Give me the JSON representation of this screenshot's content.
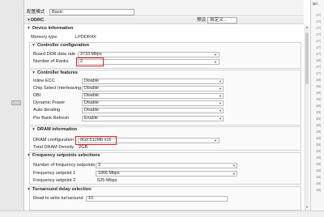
{
  "header": {
    "mode_label": "配置模式",
    "mode_value": "Basic",
    "section_title": "DDRC",
    "preset_label": "预设",
    "preset_value": "自定义..."
  },
  "device_information": {
    "title": "Device Information",
    "memory_type_label": "Memory type",
    "memory_type_value": "LPDDR4X"
  },
  "controller_configuration": {
    "title": "Controller configuration",
    "fields": [
      {
        "label": "Board DDR data rate",
        "value": "3733 Mbps"
      },
      {
        "label": "Number of Ranks",
        "value": "2"
      }
    ]
  },
  "controller_features": {
    "title": "Controller features",
    "fields": [
      {
        "label": "Inline ECC",
        "value": "Disable"
      },
      {
        "label": "Chip Select Interleaving",
        "value": "Disable"
      },
      {
        "label": "DBI",
        "value": "Disable"
      },
      {
        "label": "Dynamic Power",
        "value": "Disable"
      },
      {
        "label": "Auto derating",
        "value": "Disable"
      },
      {
        "label": "Per Bank Refresh",
        "value": "Enable"
      }
    ]
  },
  "dram_information": {
    "title": "DRAM information",
    "config_label": "DRAM configuration",
    "config_value": "8Gb:512Mb x16",
    "density_label": "Total DRAM Density",
    "density_value": "2GB"
  },
  "frequency_setpoints": {
    "title": "Frequency setpoints selections",
    "fields": [
      {
        "label": "Number of frequency setpoints",
        "value": "3"
      },
      {
        "label": "Frequency setpoint 1",
        "value": "1866 Mbps"
      },
      {
        "label": "Frequency setpoint 2",
        "value": "625 Mbps"
      }
    ]
  },
  "turnaround": {
    "title": "Turnaround delay selection",
    "fields": [
      {
        "label": "Read to write turnaround",
        "value": "10"
      }
    ]
  },
  "right_pane": {
    "header": "lpd",
    "lines": [
      "17(",
      "17(",
      "17(",
      "17(",
      "17(",
      "17(",
      "17(",
      "18(",
      "17(",
      "17(",
      "18(",
      "18(",
      "18(",
      "18(",
      "18(",
      "18(",
      "18(",
      "18(",
      "18(",
      "18(",
      "18(",
      "18(",
      "18(",
      "18(",
      "18(",
      "18(",
      "18(",
      "18("
    ]
  }
}
